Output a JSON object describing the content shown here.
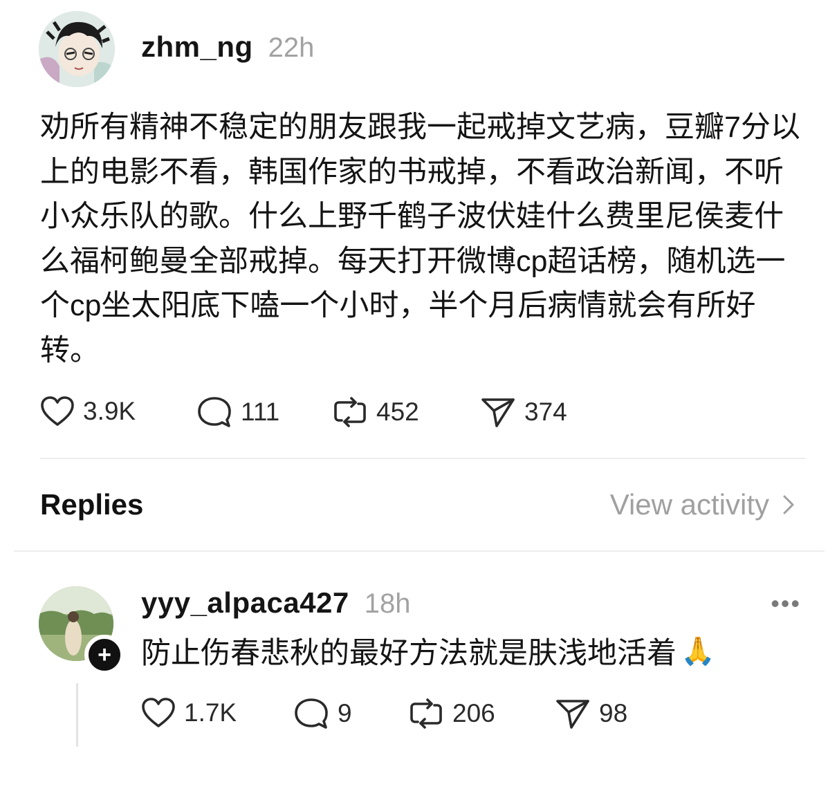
{
  "post": {
    "username": "zhm_ng",
    "time": "22h",
    "body": "劝所有精神不稳定的朋友跟我一起戒掉文艺病，豆瓣7分以上的电影不看，韩国作家的书戒掉，不看政治新闻，不听小众乐队的歌。什么上野千鹤子波伏娃什么费里尼侯麦什么福柯鲍曼全部戒掉。每天打开微博cp超话榜，随机选一个cp坐太阳底下嗑一个小时，半个月后病情就会有所好转。",
    "likes": "3.9K",
    "comments": "111",
    "reposts": "452",
    "shares": "374"
  },
  "replies_section": {
    "label": "Replies",
    "view_activity": "View activity"
  },
  "reply": {
    "username": "yyy_alpaca427",
    "time": "18h",
    "text": "防止伤春悲秋的最好方法就是肤浅地活着",
    "emoji": "🙏",
    "likes": "1.7K",
    "comments": "9",
    "reposts": "206",
    "shares": "98"
  },
  "icons": {
    "like": "heart-icon",
    "comment": "comment-bubble-icon",
    "repost": "repost-icon",
    "share": "send-icon",
    "more": "more-icon",
    "follow": "plus-icon",
    "chevron": "chevron-right-icon"
  }
}
